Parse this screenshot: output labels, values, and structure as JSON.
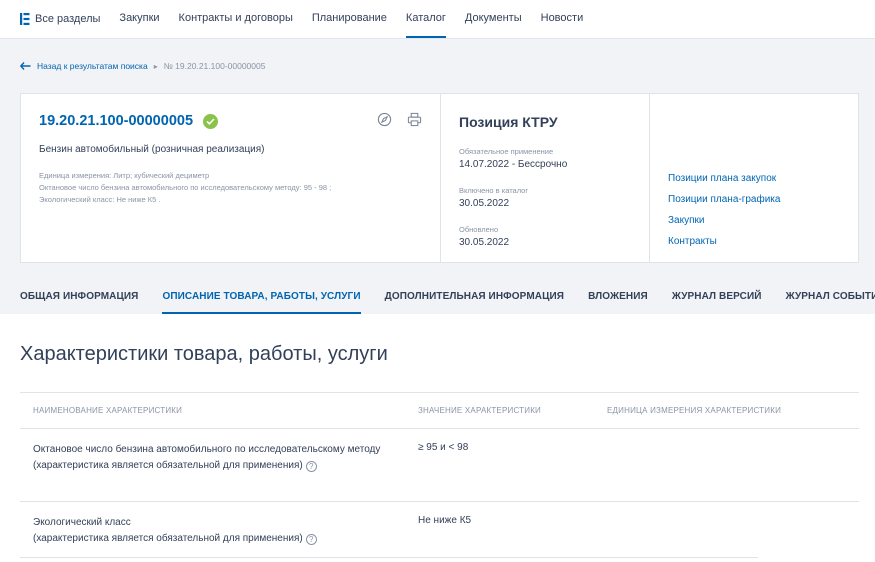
{
  "nav": {
    "items": [
      "Все разделы",
      "Закупки",
      "Контракты и договоры",
      "Планирование",
      "Каталог",
      "Документы",
      "Новости"
    ],
    "active": "Каталог"
  },
  "breadcrumb": {
    "back": "Назад к результатам поиска",
    "current": "№ 19.20.21.100-00000005"
  },
  "card": {
    "number": "19.20.21.100-00000005",
    "product_name": "Бензин автомобильный (розничная реализация)",
    "meta": [
      "Единица измерения: Литр; кубический дециметр",
      "Октановое число бензина автомобильного по исследовательскому методу: 95  -  98 ;",
      "Экологический класс: Не ниже К5 ."
    ],
    "position_title": "Позиция КТРУ",
    "fields": {
      "mandatory_label": "Обязательное применение",
      "mandatory_value": "14.07.2022  - Бессрочно",
      "included_label": "Включено в каталог",
      "included_value": "30.05.2022",
      "updated_label": "Обновлено",
      "updated_value": "30.05.2022"
    },
    "links": [
      "Позиции плана закупок",
      "Позиции плана-графика",
      "Закупки",
      "Контракты"
    ]
  },
  "tabs": [
    "ОБЩАЯ ИНФОРМАЦИЯ",
    "ОПИСАНИЕ ТОВАРА, РАБОТЫ, УСЛУГИ",
    "ДОПОЛНИТЕЛЬНАЯ ИНФОРМАЦИЯ",
    "ВЛОЖЕНИЯ",
    "ЖУРНАЛ ВЕРСИЙ",
    "ЖУРНАЛ СОБЫТИЙ"
  ],
  "active_tab": "ОПИСАНИЕ ТОВАРА, РАБОТЫ, УСЛУГИ",
  "section": {
    "title": "Характеристики товара, работы, услуги",
    "columns": [
      "НАИМЕНОВАНИЕ ХАРАКТЕРИСТИКИ",
      "ЗНАЧЕНИЕ ХАРАКТЕРИСТИКИ",
      "ЕДИНИЦА ИЗМЕРЕНИЯ ХАРАКТЕРИСТИКИ"
    ],
    "rows": [
      {
        "name": "Октановое число бензина автомобильного по исследовательскому методу",
        "note": "(характеристика является обязательной для применения)",
        "value": "≥ 95  и  < 98"
      },
      {
        "name": "Экологический класс",
        "note": "(характеристика является обязательной для применения)",
        "value": "Не ниже К5"
      }
    ]
  },
  "colors": {
    "accent": "#0065b1",
    "success": "#8bc34a",
    "text": "#334059",
    "muted": "#8a94a6"
  }
}
